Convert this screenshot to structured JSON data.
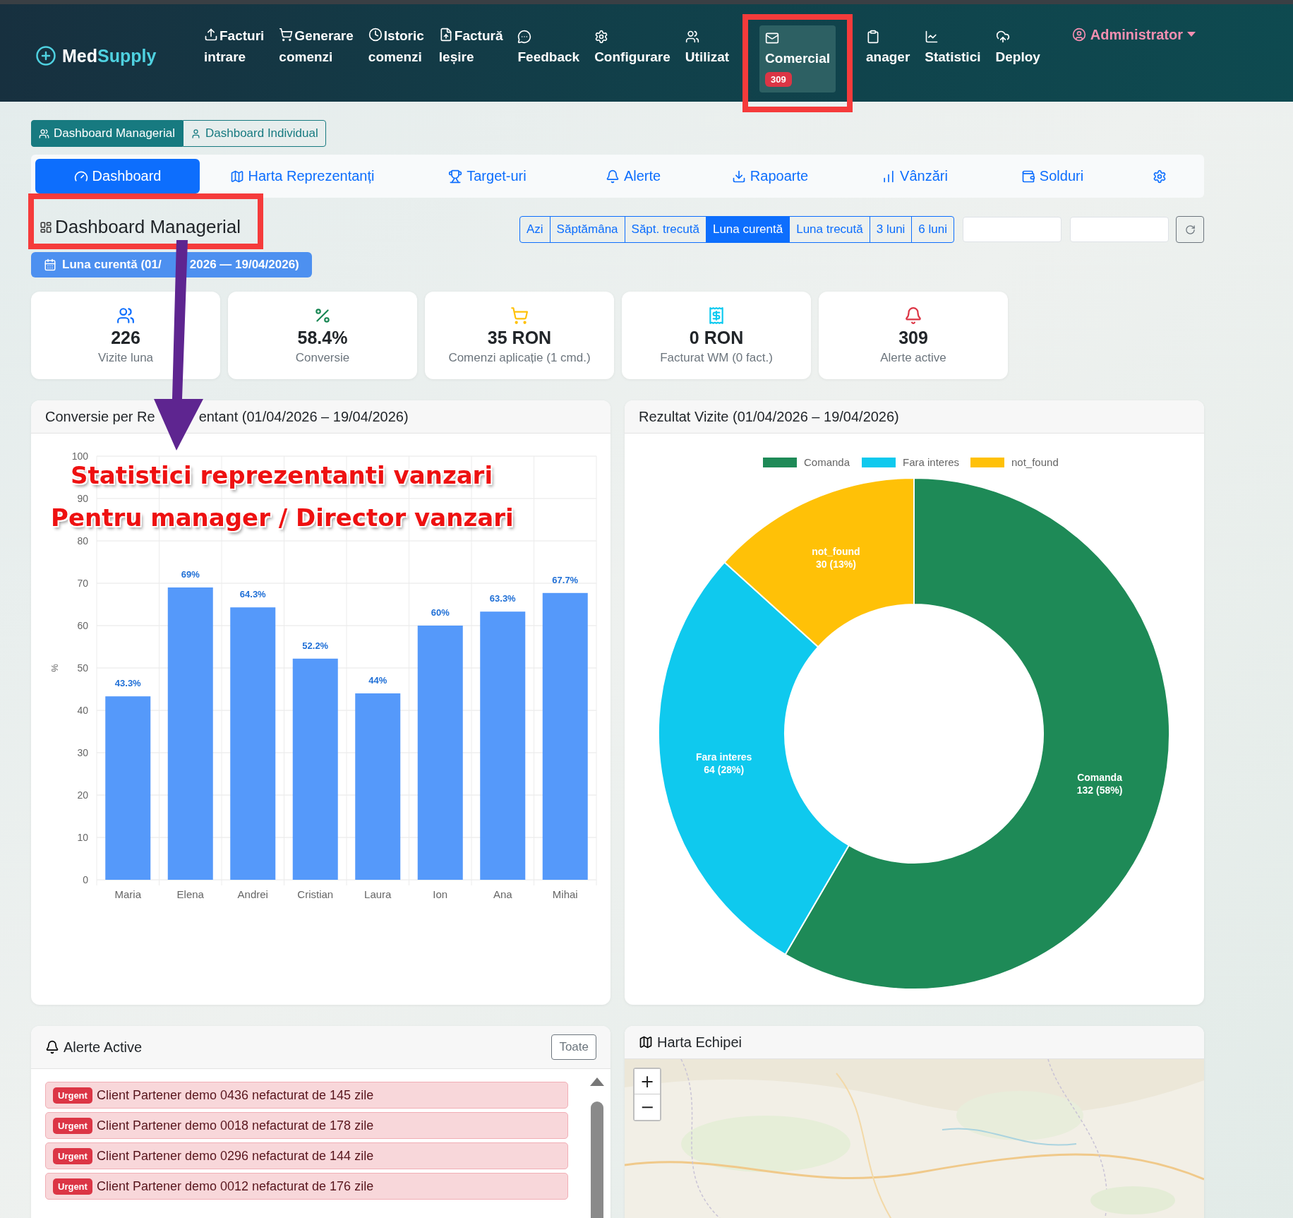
{
  "navbar": {
    "brand": {
      "first": "Med",
      "second": "Supply"
    },
    "items": [
      {
        "lines": [
          "Facturi",
          "intrare"
        ],
        "selected": false
      },
      {
        "lines": [
          "Generare",
          "comenzi"
        ],
        "selected": false
      },
      {
        "lines": [
          "Istoric",
          "comenzi"
        ],
        "selected": false
      },
      {
        "lines": [
          "Factură",
          "Ieșire"
        ],
        "selected": false
      },
      {
        "lines": [
          "Feedback"
        ],
        "selected": false
      },
      {
        "lines": [
          "Configurare"
        ],
        "selected": false
      },
      {
        "lines": [
          "Utilizat"
        ],
        "selected": false
      },
      {
        "lines": [
          "Comercial"
        ],
        "selected": true,
        "badge": "309"
      },
      {
        "lines": [
          "anager"
        ],
        "selected": false
      },
      {
        "lines": [
          "Statistici"
        ],
        "selected": false
      },
      {
        "lines": [
          "Deploy"
        ],
        "selected": false
      }
    ],
    "user": "Administrator"
  },
  "view_toggle": [
    {
      "label": "Dashboard Managerial",
      "selected": true
    },
    {
      "label": "Dashboard Individual",
      "selected": false
    }
  ],
  "tabs": [
    {
      "label": "Dashboard",
      "selected": true
    },
    {
      "label": "Harta Reprezentanți",
      "selected": false
    },
    {
      "label": "Target-uri",
      "selected": false
    },
    {
      "label": "Alerte",
      "selected": false
    },
    {
      "label": "Rapoarte",
      "selected": false
    },
    {
      "label": "Vânzări",
      "selected": false
    },
    {
      "label": "Solduri",
      "selected": false
    },
    {
      "selected": false
    }
  ],
  "page_title": "Dashboard Managerial",
  "periods": [
    {
      "label": "Azi",
      "selected": false
    },
    {
      "label": "Săptămâna",
      "selected": false
    },
    {
      "label": "Săpt. trecută",
      "selected": false
    },
    {
      "label": "Luna curentă",
      "selected": true
    },
    {
      "label": "Luna trecută",
      "selected": false
    },
    {
      "label": "3 luni",
      "selected": false
    },
    {
      "label": "6 luni",
      "selected": false
    }
  ],
  "period_badge": {
    "before": "Luna curentă (01/",
    "after": "2026 — 19/04/2026)"
  },
  "kpis": [
    {
      "value": "226",
      "label": "Vizite luna",
      "color": "#0d6efd"
    },
    {
      "value": "58.4%",
      "label": "Conversie",
      "color": "#198754"
    },
    {
      "value": "35 RON",
      "label": "Comenzi aplicație (1 cmd.)",
      "color": "#ffc107"
    },
    {
      "value": "0 RON",
      "label": "Facturat WM (0 fact.)",
      "color": "#0dcaf0"
    },
    {
      "value": "309",
      "label": "Alerte active",
      "color": "#dc3545"
    }
  ],
  "conversion_card": {
    "title": {
      "before": "Conversie per Re",
      "after": "entant (01/04/2026 – 19/04/2026)"
    },
    "chart_data": {
      "type": "bar",
      "ylabel": "%",
      "grid": true,
      "categories": [
        "Maria",
        "Elena",
        "Andrei",
        "Cristian",
        "Laura",
        "Ion",
        "Ana",
        "Mihai"
      ],
      "series": [
        {
          "color": "#5599fa",
          "values": [
            43.3,
            69,
            64.3,
            52.2,
            44,
            60,
            63.3,
            67.7
          ]
        }
      ],
      "value_labels": [
        "43.3%",
        "69%",
        "64.3%",
        "52.2%",
        "44%",
        "60%",
        "63.3%",
        "67.7%"
      ],
      "ylim": [
        0,
        100
      ],
      "yticks": [
        0,
        10,
        20,
        30,
        40,
        50,
        60,
        70,
        80,
        90,
        100
      ]
    }
  },
  "visits_card": {
    "title": "Rezultat Vizite (01/04/2026 – 19/04/2026)",
    "chart_data": {
      "type": "donut",
      "categories": [
        "Comanda",
        "Fara interes",
        "not_found"
      ],
      "series": [
        {
          "values": [
            58.4,
            28.3,
            13.3
          ]
        }
      ],
      "colors": [
        "#1e8a57",
        "#0fc9ee",
        "#ffc107"
      ],
      "legend": true,
      "value_labels": [
        "132 (58%)",
        "64 (28%)",
        "30 (13%)"
      ]
    }
  },
  "alerts_card": {
    "title": "Alerte Active",
    "button": "Toate",
    "alerts": [
      {
        "badge": "Urgent",
        "text": "Client Partener demo 0436 nefacturat de 145 zile"
      },
      {
        "badge": "Urgent",
        "text": "Client Partener demo 0018 nefacturat de 178 zile"
      },
      {
        "badge": "Urgent",
        "text": "Client Partener demo 0296 nefacturat de 144 zile"
      },
      {
        "badge": "Urgent",
        "text": "Client Partener demo 0012 nefacturat de 176 zile"
      }
    ]
  },
  "map_card": {
    "title": "Harta Echipei",
    "zoom_in": "+",
    "zoom_out": "−"
  },
  "annotations": {
    "lines": [
      "Statistici reprezentanti vanzari",
      "Pentru manager / Director vanzari"
    ]
  }
}
